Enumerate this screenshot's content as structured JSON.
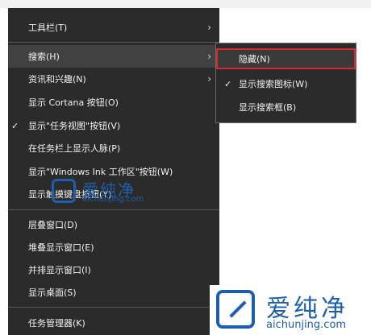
{
  "context_menu": {
    "items": [
      {
        "label": "工具栏(T)",
        "has_submenu": true,
        "checked": false
      },
      {
        "label": "搜索(H)",
        "has_submenu": true,
        "checked": false
      },
      {
        "label": "资讯和兴趣(N)",
        "has_submenu": true,
        "checked": false
      },
      {
        "label": "显示 Cortana 按钮(O)",
        "has_submenu": false,
        "checked": false
      },
      {
        "label": "显示\"任务视图\"按钮(V)",
        "has_submenu": false,
        "checked": true
      },
      {
        "label": "在任务栏上显示人脉(P)",
        "has_submenu": false,
        "checked": false
      },
      {
        "label": "显示\"Windows Ink 工作区\"按钮(W)",
        "has_submenu": false,
        "checked": false
      },
      {
        "label": "显示触摸键盘按钮(Y)",
        "has_submenu": false,
        "checked": false
      },
      {
        "label": "层叠窗口(D)",
        "has_submenu": false,
        "checked": false
      },
      {
        "label": "堆叠显示窗口(E)",
        "has_submenu": false,
        "checked": false
      },
      {
        "label": "并排显示窗口(I)",
        "has_submenu": false,
        "checked": false
      },
      {
        "label": "显示桌面(S)",
        "has_submenu": false,
        "checked": false
      },
      {
        "label": "任务管理器(K)",
        "has_submenu": false,
        "checked": false
      }
    ],
    "check_glyph": "✓",
    "arrow_glyph": "›"
  },
  "search_submenu": {
    "items": [
      {
        "label": "隐藏(N)",
        "checked": false,
        "highlighted": true
      },
      {
        "label": "显示搜索图标(W)",
        "checked": true,
        "highlighted": false
      },
      {
        "label": "显示搜索框(B)",
        "checked": false,
        "highlighted": false
      }
    ]
  },
  "watermark": {
    "brand": "爱纯净",
    "url": "aichunjing.com"
  },
  "colors": {
    "menu_bg": "#2b2b2b",
    "highlight_border": "#d9272e",
    "watermark_blue": "#1c5fae"
  }
}
